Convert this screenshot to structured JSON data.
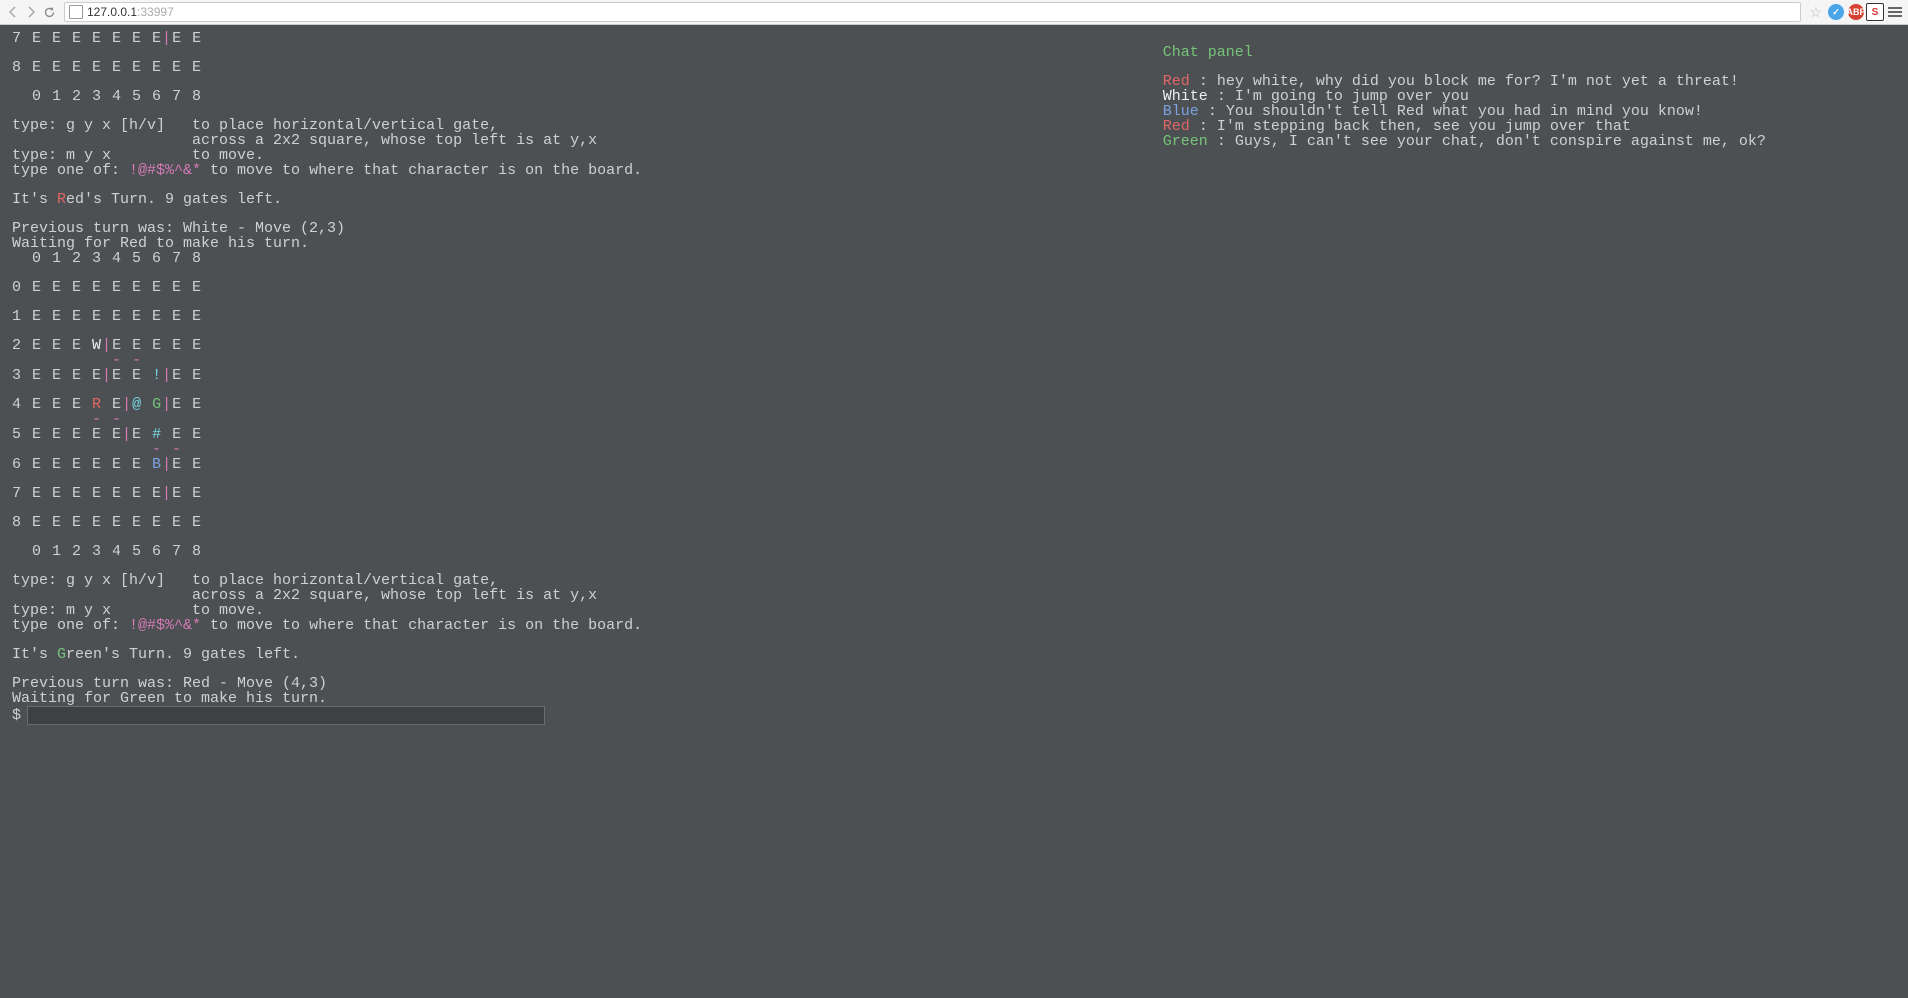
{
  "browser": {
    "url_host": "127.0.0.1",
    "url_port": ":33997"
  },
  "colors": {
    "bg": "#4d5053",
    "fg": "#d0d0d0",
    "red": "#e06666",
    "white": "#eeeeee",
    "blue": "#7aa2e0",
    "green": "#76c47a",
    "cyan": "#74d6e0",
    "gate": "#d47ab5"
  },
  "board_common": {
    "col_header": "  0 1 2 3 4 5 6 7 8",
    "col_footer": "  0 1 2 3 4 5 6 7 8",
    "instr_gate": "type: g y x [h/v]   to place horizontal/vertical gate,",
    "instr_gate2": "                    across a 2x2 square, whose top left is at y,x",
    "instr_move": "type: m y x         to move.",
    "instr_special_pre": "type one of: ",
    "instr_special_syms": "!@#$%^&*",
    "instr_special_post": " to move to where that character is on the board."
  },
  "state1": {
    "row7": {
      "i": "7",
      "pre": " E E E E E E E",
      "pipe": "|",
      "post": "E E"
    },
    "row8": {
      "i": "8",
      "post": " E E E E E E E E E"
    },
    "turn_pre": "It's ",
    "turn_letter": "R",
    "turn_post": "ed's Turn. 9 gates left.",
    "prev": "Previous turn was: White - Move (2,3)",
    "wait": "Waiting for Red to make his turn."
  },
  "state2": {
    "row0": {
      "i": "0",
      "txt": " E E E E E E E E E"
    },
    "row1": {
      "i": "1",
      "txt": " E E E E E E E E E"
    },
    "row2": {
      "i": "2",
      "pre": " E E E ",
      "W": "W",
      "pipe": "|",
      "post": "E E E E E"
    },
    "row2b": {
      "pad": "          ",
      "d": "- -"
    },
    "row3": {
      "i": "3",
      "pre": " E E E E",
      "p1": "|",
      "mid": "E E ",
      "bang": "!",
      "p2": "|",
      "post": "E E"
    },
    "row4": {
      "i": "4",
      "pre": " E E E ",
      "R": "R",
      "sp": " E",
      "p1": "|",
      "at": "@",
      "sp2": " ",
      "G": "G",
      "p2": "|",
      "post": "E E"
    },
    "row4b": {
      "pad": "        ",
      "d": "- -"
    },
    "row5": {
      "i": "5",
      "pre": " E E E E E",
      "p1": "|",
      "mid": "E ",
      "hash": "#",
      "post": " E E"
    },
    "row5b": {
      "pad": "              ",
      "d": "- -"
    },
    "row6": {
      "i": "6",
      "pre": " E E E E E E ",
      "B": "B",
      "p1": "|",
      "post": "E E"
    },
    "row7": {
      "i": "7",
      "pre": " E E E E E E E",
      "p1": "|",
      "post": "E E"
    },
    "row8": {
      "i": "8",
      "txt": " E E E E E E E E E"
    },
    "turn_pre": "It's ",
    "turn_letter": "G",
    "turn_post": "reen's Turn. 9 gates left.",
    "prev": "Previous turn was: Red - Move (4,3)",
    "wait": "Waiting for Green to make his turn."
  },
  "prompt": {
    "symbol": "$",
    "value": ""
  },
  "chat": {
    "title": "Chat panel",
    "lines": [
      {
        "who": "Red",
        "color": "red",
        "text": " : hey white, why did you block me for? I'm not yet a threat!"
      },
      {
        "who": "White",
        "color": "white",
        "text": " : I'm going to jump over you"
      },
      {
        "who": "Blue",
        "color": "blue",
        "text": " : You shouldn't tell Red what you had in mind you know!"
      },
      {
        "who": "Red",
        "color": "red",
        "text": " : I'm stepping back then, see you jump over that"
      },
      {
        "who": "Green",
        "color": "green",
        "text": " : Guys, I can't see your chat, don't conspire against me, ok?"
      }
    ]
  }
}
